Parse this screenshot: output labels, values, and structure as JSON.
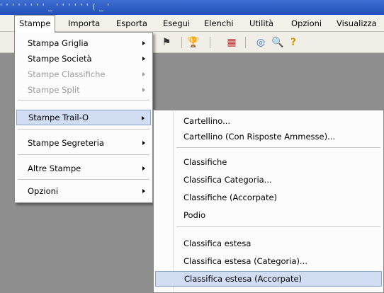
{
  "titlebar": {
    "text": "' ' ' ' ' ' ' ' _ ' ' ' ' ' ' ( _ '"
  },
  "menubar": {
    "items": [
      "Stampe",
      "Importa",
      "Esporta",
      "Esegui",
      "Elenchi",
      "Utilità",
      "Opzioni",
      "Visualizza"
    ]
  },
  "toolbar": {
    "icons": [
      "flags-icon",
      "trophy-icon",
      "report-icon",
      "globe-icon",
      "magnifier-icon",
      "help-icon"
    ],
    "glyphs": [
      "⚑",
      "🏆",
      "▦",
      "◎",
      "🔍",
      "?"
    ]
  },
  "stampe_menu": {
    "items": [
      {
        "label": "Stampa Griglia",
        "enabled": true,
        "submenu": true
      },
      {
        "label": "Stampe Società",
        "enabled": true,
        "submenu": true
      },
      {
        "label": "Stampe Classifiche",
        "enabled": false,
        "submenu": true
      },
      {
        "label": "Stampe Split",
        "enabled": false,
        "submenu": true
      },
      {
        "label": "Stampe Trail-O",
        "enabled": true,
        "submenu": true,
        "highlighted": true
      },
      {
        "label": "Stampe Segreteria",
        "enabled": true,
        "submenu": true
      },
      {
        "label": "Altre Stampe",
        "enabled": true,
        "submenu": true
      },
      {
        "label": "Opzioni",
        "enabled": true,
        "submenu": true
      }
    ]
  },
  "trailo_submenu": {
    "items": [
      {
        "label": "Cartellino..."
      },
      {
        "label": "Cartellino (Con Risposte Ammesse)..."
      },
      {
        "label": "Classifiche"
      },
      {
        "label": "Classifica Categoria..."
      },
      {
        "label": "Classifiche (Accorpate)"
      },
      {
        "label": "Podio"
      },
      {
        "label": "Classifica estesa"
      },
      {
        "label": "Classifica estesa (Categoria)..."
      },
      {
        "label": "Classifica estesa (Accorpate)",
        "highlighted": true
      }
    ]
  },
  "colors": {
    "menu_highlight": "#d0ddf3",
    "menu_highlight_border": "#8aa4cc",
    "workspace": "#8e8e8e",
    "title_bar": "#2f5fc4"
  }
}
